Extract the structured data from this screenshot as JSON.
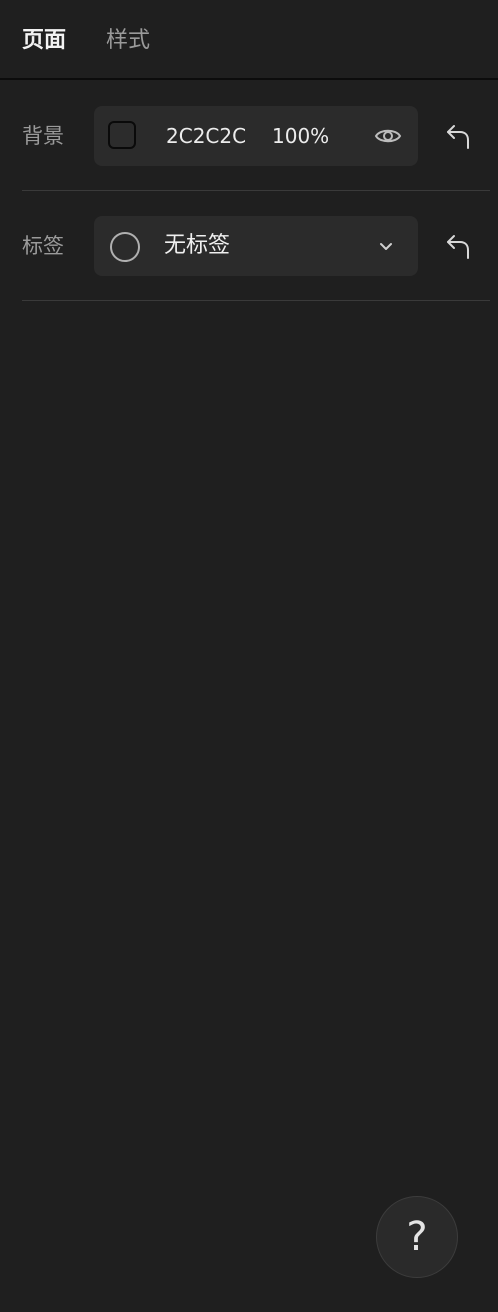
{
  "tabs": [
    {
      "label": "页面",
      "active": true
    },
    {
      "label": "样式",
      "active": false
    }
  ],
  "background_row": {
    "label": "背景",
    "color_hex": "2C2C2C",
    "swatch_color": "#2C2C2C",
    "opacity": "100%",
    "visibility_icon": "eye-icon",
    "reset_icon": "undo-arrow-icon"
  },
  "tag_row": {
    "label": "标签",
    "value": "无标签",
    "dropdown_icon": "chevron-down-icon",
    "reset_icon": "undo-arrow-icon"
  },
  "help_button": {
    "label": "?"
  }
}
